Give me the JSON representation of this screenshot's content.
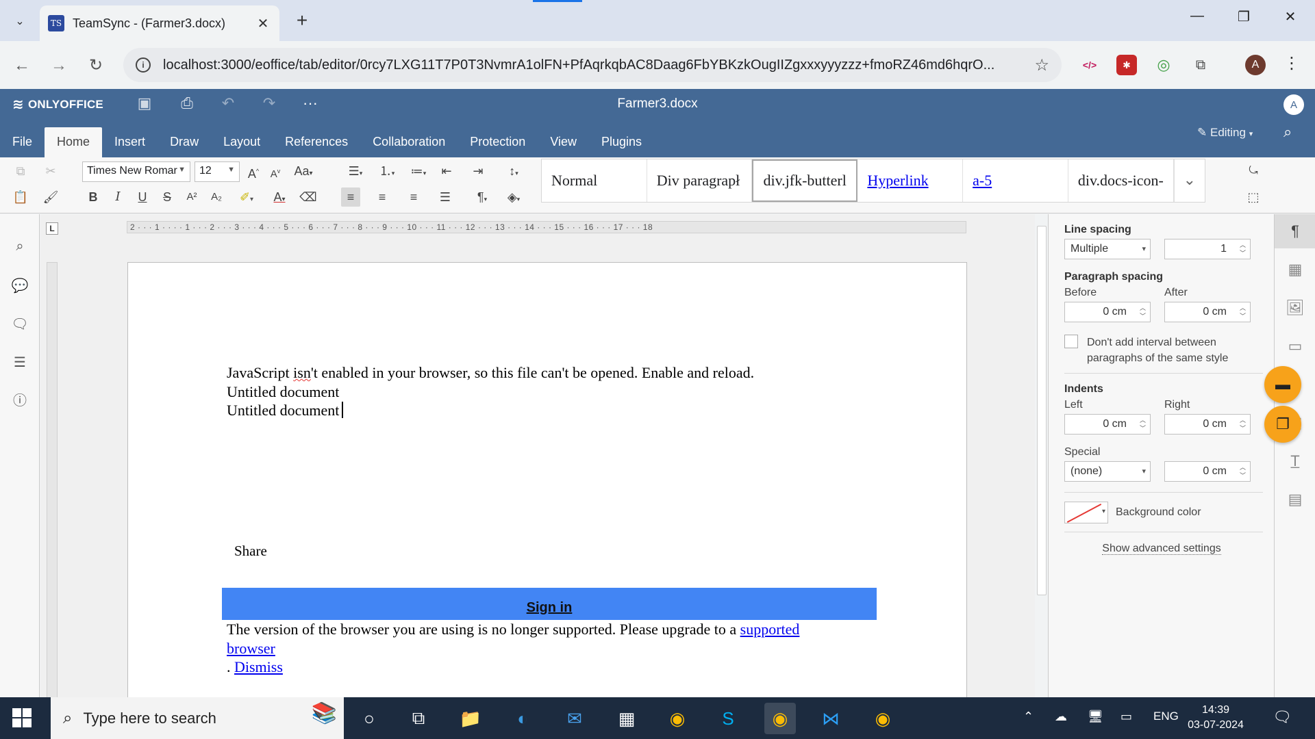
{
  "browser": {
    "tab_title": "TeamSync - (Farmer3.docx)",
    "tab_favicon": "TS",
    "url": "localhost:3000/eoffice/tab/editor/0rcy7LXG11T7P0T3NvmrA1olFN+PfAqrkqbAC8Daag6FbYBKzkOugIIZgxxxyyyzzz+fmoRZ46md6hqrO...",
    "profile_initial": "A",
    "accent": "#1a73e8"
  },
  "app": {
    "brand": "ONLYOFFICE",
    "document_title": "Farmer3.docx",
    "user_initial": "A",
    "header_color": "#446995",
    "mode_label": "Editing",
    "menu_tabs": [
      {
        "label": "File"
      },
      {
        "label": "Home"
      },
      {
        "label": "Insert"
      },
      {
        "label": "Draw"
      },
      {
        "label": "Layout"
      },
      {
        "label": "References"
      },
      {
        "label": "Collaboration"
      },
      {
        "label": "Protection"
      },
      {
        "label": "View"
      },
      {
        "label": "Plugins"
      }
    ],
    "active_tab": "Home"
  },
  "ribbon": {
    "font_name": "Times New Romar",
    "font_size": "12",
    "case_label": "Aa",
    "styles": [
      {
        "label": "Normal"
      },
      {
        "label": "Div paragrapł"
      },
      {
        "label": "div.jfk-butterl"
      },
      {
        "label": "Hyperlink"
      },
      {
        "label": "a-5"
      },
      {
        "label": "div.docs-icon-"
      }
    ],
    "selected_style": "div.jfk-butterl"
  },
  "ruler": {
    "corner_label": "L",
    "ticks": "2 · · · 1 · · · · 1 · · · 2 · · · 3 · · · 4 · · · 5 · · · 6 · · · 7 · · · 8 · · · 9 · · · 10 · · · 11 · · · 12 · · · 13 · · · 14 · · · 15 · · · 16 · · · 17 · · · 18"
  },
  "document": {
    "line1_pre": "JavaScript ",
    "line1_misspelled": "isn",
    "line1_post": "'t enabled in your browser, so this file can't be opened. Enable and reload.",
    "line2": "Untitled document",
    "line3": "Untitled document",
    "share": "Share",
    "signin": "Sign in",
    "signin_bg": "#4285f4",
    "browser_msg": "The version of the browser you are using is no longer supported. Please upgrade to a ",
    "supported_link": "supported",
    "browser_link": "browser",
    "dismiss_prefix": ". ",
    "dismiss_link": "Dismiss"
  },
  "paragraph_settings": {
    "line_spacing_label": "Line spacing",
    "line_spacing_mode": "Multiple",
    "line_spacing_value": "1",
    "paragraph_spacing_label": "Paragraph spacing",
    "before_label": "Before",
    "before_value": "0 cm",
    "after_label": "After",
    "after_value": "0 cm",
    "dont_add_interval_line1": "Don't add interval between",
    "dont_add_interval_line2": "paragraphs of the same style",
    "indents_label": "Indents",
    "left_label": "Left",
    "left_value": "0 cm",
    "right_label": "Right",
    "right_value": "0 cm",
    "special_label": "Special",
    "special_value": "(none)",
    "special_amount": "0 cm",
    "background_color_label": "Background color",
    "show_advanced": "Show advanced settings"
  },
  "taskbar": {
    "search_placeholder": "Type here to search",
    "language": "ENG",
    "time": "14:39",
    "date": "03-07-2024",
    "bg_color": "#1c2b3f"
  }
}
